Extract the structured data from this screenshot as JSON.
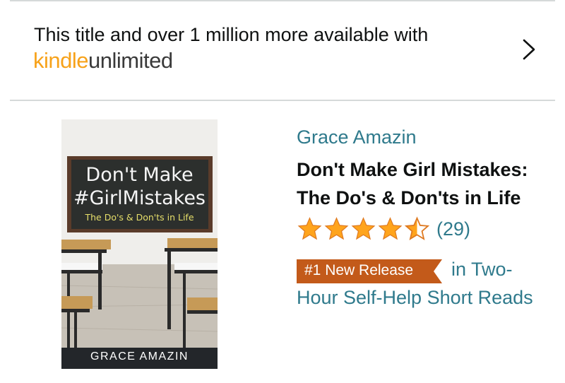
{
  "kindle_unlimited": {
    "promo_text": "This title and over 1 million more available with",
    "logo_kindle": "kindle",
    "logo_unlimited": "unlimited"
  },
  "book": {
    "cover": {
      "line1": "Don't Make",
      "line2": "#GirlMistakes",
      "subtitle": "The Do's & Don'ts in Life",
      "author": "GRACE AMAZIN"
    },
    "author": "Grace Amazin",
    "title": "Don't Make Girl Mistakes: The Do's & Don'ts in Life",
    "rating": {
      "stars": 4.5,
      "count_text": "(29)"
    },
    "badge": {
      "label": "#1 New Release",
      "color": "#c35a1a"
    },
    "category_text": "in Two-Hour Self-Help Short Reads"
  },
  "colors": {
    "link": "#2f7a8c",
    "star": "#ffa41c",
    "kindle_orange": "#f7a21a"
  }
}
